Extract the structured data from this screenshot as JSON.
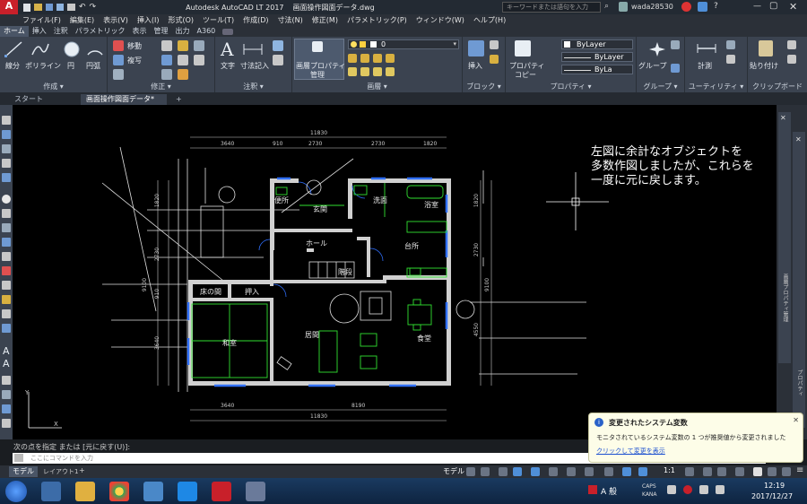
{
  "titlebar": {
    "app_title": "Autodesk AutoCAD LT 2017",
    "file_name": "画面操作図面データ.dwg",
    "search_placeholder": "キーワードまたは語句を入力",
    "user": "wada28530",
    "app_letter": "A",
    "app_sub": "LT"
  },
  "menubar": {
    "items": [
      "ファイル(F)",
      "編集(E)",
      "表示(V)",
      "挿入(I)",
      "形式(O)",
      "ツール(T)",
      "作成(D)",
      "寸法(N)",
      "修正(M)",
      "パラメトリック(P)",
      "ウィンドウ(W)",
      "ヘルプ(H)"
    ]
  },
  "ribbon_tabs": {
    "items": [
      "ホーム",
      "挿入",
      "注釈",
      "パラメトリック",
      "表示",
      "管理",
      "出力",
      "A360"
    ]
  },
  "ribbon": {
    "draw": {
      "title": "作成 ▾",
      "line": "線分",
      "polyline": "ポリライン",
      "circle": "円",
      "arc": "円弧"
    },
    "modify": {
      "title": "修正 ▾",
      "move": "移動",
      "copy": "複写"
    },
    "annotation": {
      "title": "注釈 ▾",
      "text": "文字",
      "dim": "寸法記入"
    },
    "layers": {
      "title": "画層 ▾",
      "props": "画層プロパティ",
      "manage": "管理",
      "layer_value": "0"
    },
    "block": {
      "title": "ブロック ▾",
      "insert": "挿入"
    },
    "properties": {
      "title": "プロパティ ▾",
      "match": "プロパティ",
      "copy": "コピー",
      "bylayer1": "ByLayer",
      "bylayer2": "ByLayer",
      "bylayer3": "ByLa"
    },
    "groups": {
      "title": "グループ ▾",
      "group": "グループ"
    },
    "utilities": {
      "title": "ユーティリティ ▾",
      "measure": "計測"
    },
    "clipboard": {
      "title": "クリップボード",
      "paste": "貼り付け"
    }
  },
  "doctabs": {
    "start": "スタート",
    "active": "画面操作図面データ*",
    "add": "+"
  },
  "drawing": {
    "rooms": [
      "便所",
      "玄関",
      "洗面",
      "浴室",
      "ホール",
      "台所",
      "階段",
      "床の間",
      "押入",
      "和室",
      "居間",
      "食堂"
    ],
    "dims_top": [
      "11830",
      "3640",
      "910",
      "2730",
      "2730",
      "1820"
    ],
    "dims_bottom": [
      "3640",
      "8190",
      "11830"
    ],
    "dims_left": [
      "1820",
      "2730",
      "910",
      "9100",
      "3640"
    ],
    "dims_right": [
      "1820",
      "2730",
      "9100",
      "4550"
    ],
    "note_lines": [
      "左図に余計なオブジェクトを",
      "多数作図しましたが、これらを",
      "一度に元に戻します。"
    ],
    "ucs_y": "Y",
    "ucs_x": "X"
  },
  "rightpanel": {
    "properties_label": "画層プロパティ管理",
    "props2": "プロパティ"
  },
  "commandline": {
    "history": "次の点を指定 または [元に戻す(U)]:",
    "placeholder": "ここにコマンドを入力"
  },
  "statusbar": {
    "model_tab": "モデル",
    "layout_tab": "レイアウト1",
    "add": "+",
    "model_btn": "モデル",
    "scale": "1:1"
  },
  "notification": {
    "title": "変更されたシステム変数",
    "body": "モニタされているシステム変数の 1 つが推奨値から変更されました",
    "link": "クリックして変更を表示"
  },
  "taskbar": {
    "time": "12:19",
    "date": "2017/12/27",
    "ime": "A 般",
    "caps": "CAPS",
    "kana": "KANA"
  }
}
